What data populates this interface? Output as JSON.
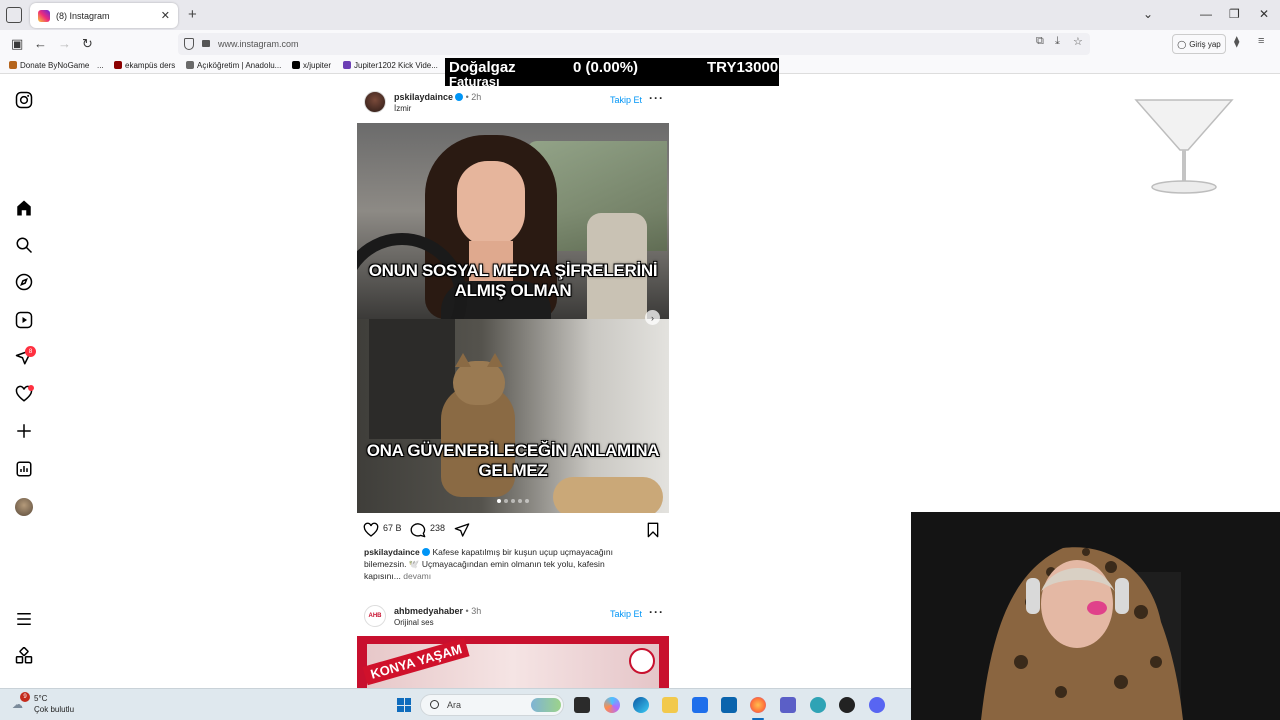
{
  "browser": {
    "tab_title": "(8) Instagram",
    "url": "www.instagram.com",
    "login_label": "Giriş yap",
    "bookmarks": [
      "Donate ByNoGame",
      "...",
      "ekampüs ders",
      "Açıköğretim | Anadolu...",
      "x/jupiter",
      "Jupiter1202 Kick Vide..."
    ]
  },
  "overlay": {
    "left_text": "Doğalgaz",
    "mid_text": "0 (0.00%)",
    "right_text": "TRY13000",
    "sub_text": "Faturası"
  },
  "sidebar": {
    "items": [
      "instagram-logo-icon",
      "home-icon",
      "search-icon",
      "explore-icon",
      "reels-icon",
      "messages-icon",
      "notifications-icon",
      "create-icon",
      "dashboard-icon",
      "profile-avatar",
      "menu-icon",
      "threads-icon"
    ],
    "messages_badge": "8"
  },
  "post1": {
    "username": "pskilaydaince",
    "time": "2h",
    "location": "İzmir",
    "follow_label": "Takip Et",
    "image_text_top": "ONUN SOSYAL MEDYA ŞİFRELERİNİ ALMIŞ OLMAN",
    "image_text_bottom": "ONA GÜVENEBİLECEĞİN ANLAMINA GELMEZ",
    "likes": "67 B",
    "comments": "238",
    "caption_user": "pskilaydaince",
    "caption_text": "Kafese kapatılmış bir kuşun uçup uçmayacağını bilemezsin. 🕊️ Uçmayacağından emin olmanın tek yolu, kafesin kapısını...",
    "more_label": "devamı"
  },
  "post2": {
    "username": "ahbmedyahaber",
    "time": "3h",
    "audio": "Orijinal ses",
    "follow_label": "Takip Et",
    "image_text": "KONYA YAŞAM"
  },
  "taskbar": {
    "temp": "5°C",
    "weather": "Çok bulutlu",
    "weather_badge": "9",
    "search_placeholder": "Ara"
  }
}
